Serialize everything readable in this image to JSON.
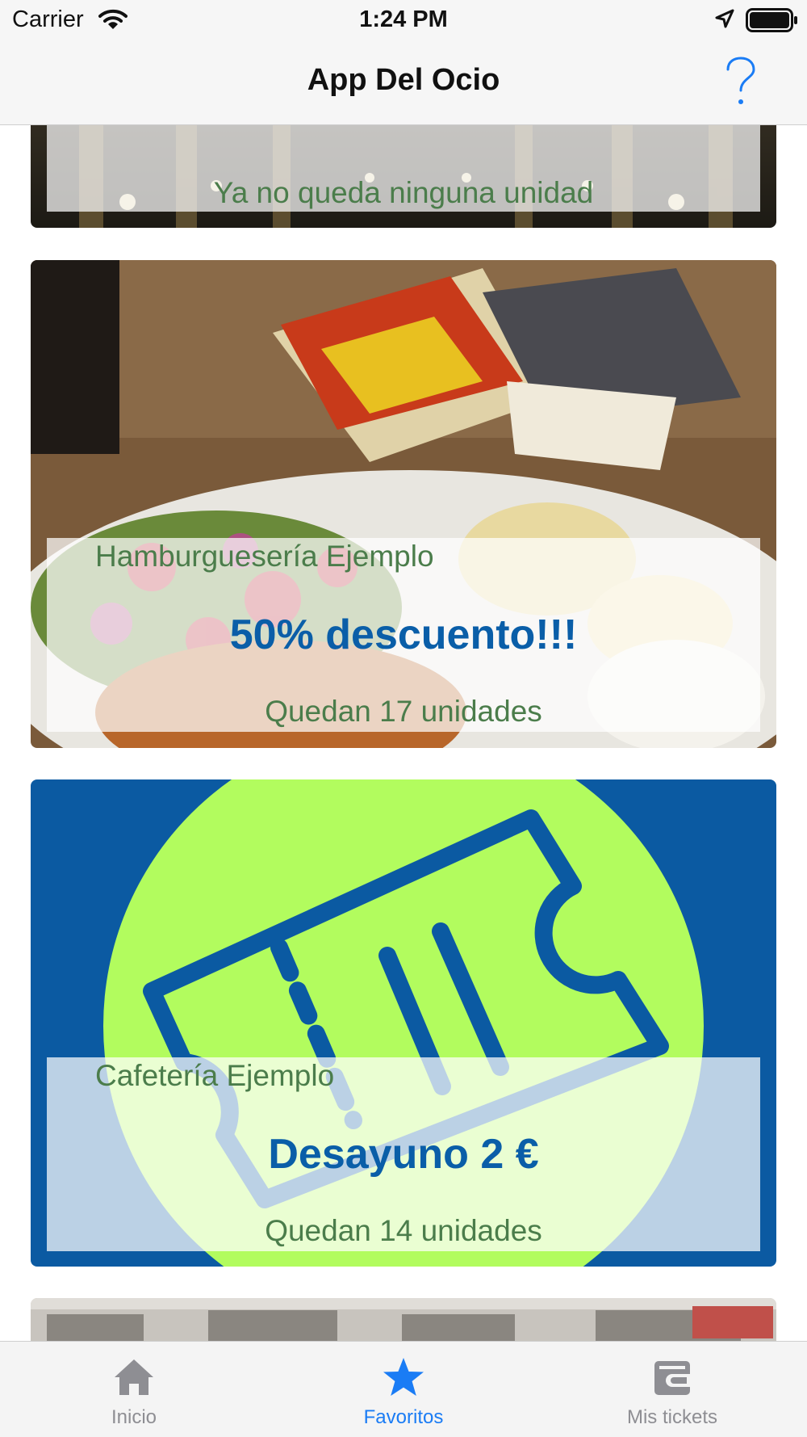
{
  "status_bar": {
    "carrier": "Carrier",
    "time": "1:24 PM"
  },
  "nav": {
    "title": "App Del Ocio",
    "help_icon": "question-mark-icon"
  },
  "cards": [
    {
      "name": "",
      "offer": "",
      "units": "Ya no queda ninguna unidad"
    },
    {
      "name": "Hamburguesería Ejemplo",
      "offer": "50% descuento!!!",
      "units": "Quedan 17 unidades"
    },
    {
      "name": "Cafetería Ejemplo",
      "offer": "Desayuno 2 €",
      "units": "Quedan 14 unidades"
    }
  ],
  "tabs": [
    {
      "label": "Inicio",
      "icon": "home-icon",
      "selected": false
    },
    {
      "label": "Favoritos",
      "icon": "star-icon",
      "selected": true
    },
    {
      "label": "Mis tickets",
      "icon": "wallet-icon",
      "selected": false
    }
  ],
  "colors": {
    "accent": "#1a7cf5",
    "tab_inactive": "#8e8e93",
    "text_green": "#4b7d4b",
    "offer_blue": "#0a5ea8",
    "ticket_bg_blue": "#0b5aa2",
    "ticket_circle_green": "#b2fc5e"
  }
}
